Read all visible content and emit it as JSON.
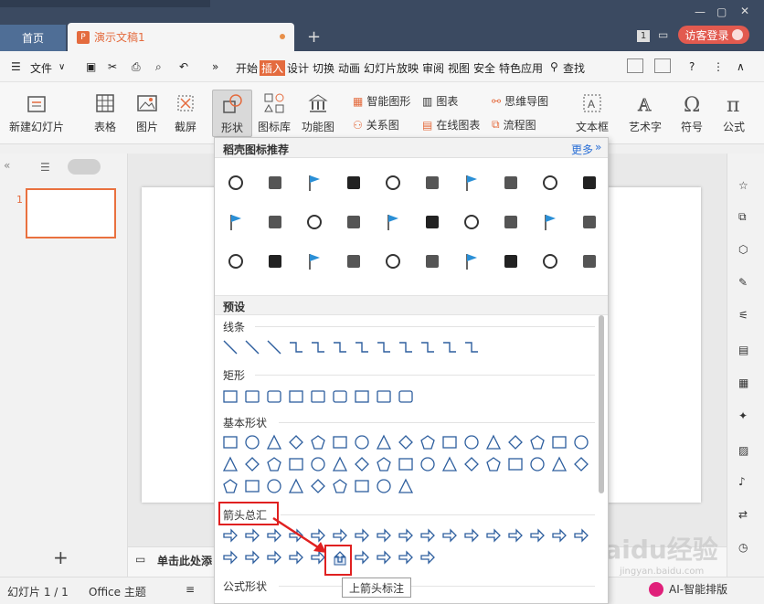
{
  "titlebar": {
    "home_tab": "首页",
    "doc_tab": "演示文稿1",
    "doc_icon": "P",
    "new_tab": "+",
    "page_badge": "1",
    "login": "访客登录",
    "colors": {
      "bar": "#3b4a61",
      "accent": "#e46b3e",
      "login": "#e25a4f"
    }
  },
  "menubar": {
    "file": "文件",
    "more": "»",
    "items": [
      "开始",
      "插入",
      "设计",
      "切换",
      "动画",
      "幻灯片放映",
      "审阅",
      "视图",
      "安全",
      "特色应用"
    ],
    "active": "插入",
    "search": "查找",
    "help": "?"
  },
  "ribbon": {
    "new_slide": "新建幻灯片",
    "table": "表格",
    "picture": "图片",
    "screenshot": "截屏",
    "shape": "形状",
    "icon_lib": "图标库",
    "func_chart": "功能图",
    "smart_shape": "智能图形",
    "chart": "图表",
    "mind_map": "思维导图",
    "relation": "关系图",
    "online_chart": "在线图表",
    "flowchart": "流程图",
    "textbox": "文本框",
    "art_text": "艺术字",
    "symbol": "符号",
    "formula": "公式"
  },
  "dropdown": {
    "header": "稻壳图标推荐",
    "more": "更多",
    "preset": "预设",
    "sections": {
      "lines": "线条",
      "rect": "矩形",
      "basic": "基本形状",
      "arrows": "箭头总汇",
      "formula": "公式形状"
    },
    "tooltip": "上箭头标注"
  },
  "leftpanel": {
    "slide_number": "1",
    "add": "+",
    "collapse": "«"
  },
  "notes": {
    "placeholder": "单击此处添"
  },
  "statusbar": {
    "slide_count": "幻灯片 1 / 1",
    "theme": "Office 主题",
    "ai": "AI-智能排版"
  },
  "watermark": {
    "logo": "Baidu经验",
    "url": "jingyan.baidu.com"
  }
}
